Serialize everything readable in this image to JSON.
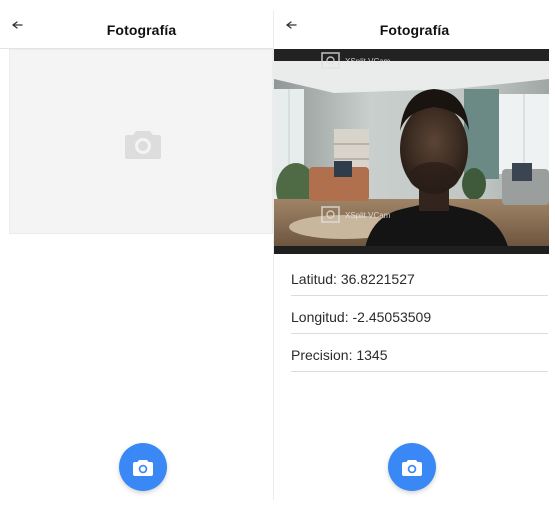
{
  "screens": [
    {
      "appbar": {
        "title": "Fotografía",
        "back_icon": "arrow-back-icon"
      },
      "placeholder_icon": "camera-icon",
      "fab": {
        "icon": "camera-icon"
      }
    },
    {
      "appbar": {
        "title": "Fotografía",
        "back_icon": "arrow-back-icon"
      },
      "photo": {
        "watermark_text_1": "XSplit VCam",
        "watermark_text_2": "XSplit VCam"
      },
      "info": [
        {
          "text": "Latitud: 36.8221527"
        },
        {
          "text": "Longitud: -2.45053509"
        },
        {
          "text": "Precision: 1345"
        }
      ],
      "fab": {
        "icon": "camera-icon"
      }
    }
  ],
  "colors": {
    "accent": "#3a88f5",
    "placeholder_bg": "#f4f4f4",
    "placeholder_icon": "#dddddd",
    "divider": "#dcdcdc"
  }
}
